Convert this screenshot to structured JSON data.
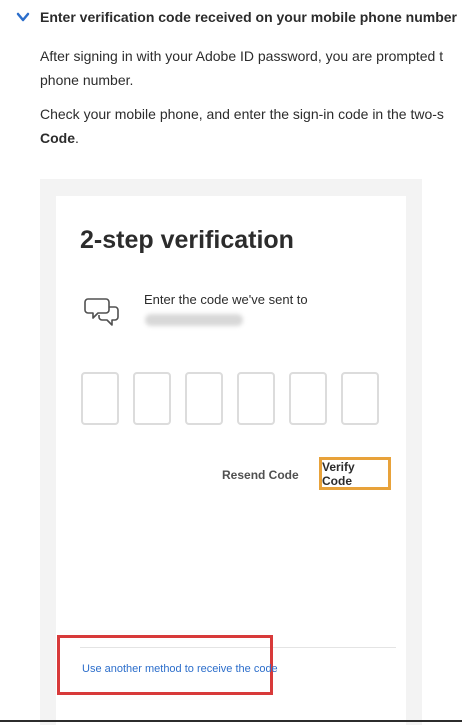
{
  "header": {
    "title": "Enter verification code received on your mobile phone number",
    "icon": "chevron-down-icon"
  },
  "paragraphs": {
    "p1_line1": "After signing in with your Adobe ID password, you are prompted t",
    "p1_line2": "phone number.",
    "p2_line1": "Check your mobile phone, and enter the sign-in code in the two-s",
    "p2_bold": "Code",
    "p2_end": "."
  },
  "dialog": {
    "title": "2-step verification",
    "icon": "chat-bubbles-icon",
    "sent_text": "Enter the code we've sent to",
    "code_boxes": [
      "",
      "",
      "",
      "",
      "",
      ""
    ],
    "resend_label": "Resend Code",
    "verify_label": "Verify Code",
    "other_method_label": "Use another method to receive the code"
  },
  "colors": {
    "accent_link": "#2c6ecb",
    "highlight_orange": "#e8a23a",
    "highlight_red": "#d83a3a",
    "chevron": "#2c6ecb"
  }
}
